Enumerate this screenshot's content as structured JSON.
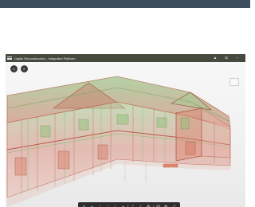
{
  "app": {
    "title": "Digital Reconstruction - Integrated Platform",
    "title_icons": [
      "menu-icon",
      "user-icon",
      "download-icon",
      "more-icon"
    ]
  },
  "viewport": {
    "left_buttons": [
      "home-icon",
      "layers-icon"
    ],
    "colors": {
      "model_red": "#d9735f",
      "model_green": "#8fc276",
      "background": "#f1f1f1"
    }
  },
  "toolbar": {
    "tools": [
      {
        "name": "select-icon",
        "glyph": "↖"
      },
      {
        "name": "walk-icon",
        "glyph": "●"
      },
      {
        "name": "orbit-icon",
        "glyph": "↕"
      },
      {
        "name": "pan-icon",
        "glyph": "↕"
      },
      {
        "name": "section-icon",
        "glyph": "⊥"
      },
      {
        "name": "camera-icon",
        "glyph": "▪"
      },
      {
        "name": "measure-icon",
        "glyph": "⁄"
      },
      {
        "name": "markup-icon",
        "glyph": "⁄"
      },
      {
        "name": "model-tree-icon",
        "glyph": "⁂"
      },
      {
        "name": "properties-icon",
        "glyph": "▤"
      },
      {
        "name": "settings-icon",
        "glyph": "⚙"
      },
      {
        "name": "fullscreen-icon",
        "glyph": "⤢"
      }
    ],
    "active": "walk-icon"
  }
}
